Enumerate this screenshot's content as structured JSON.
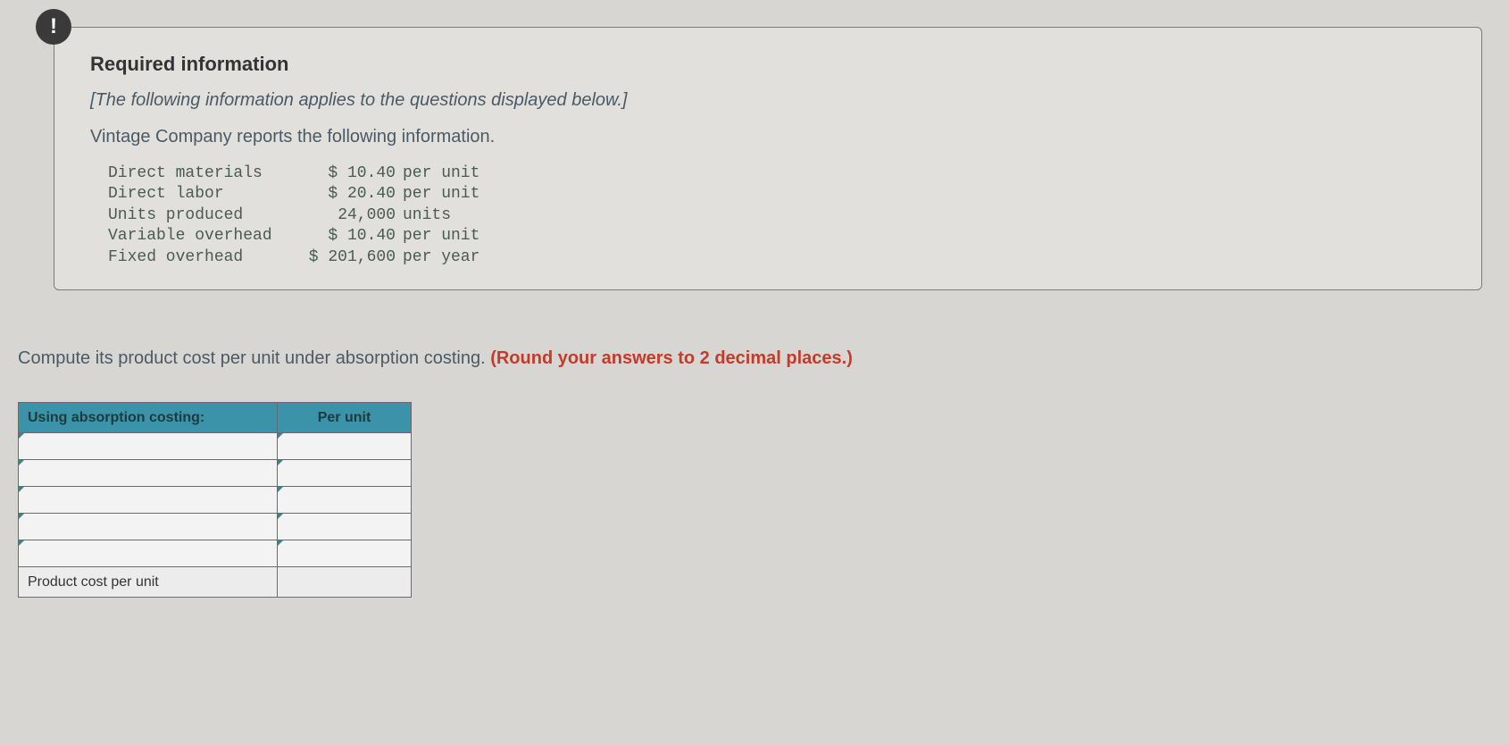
{
  "badge": "!",
  "info": {
    "heading": "Required information",
    "note": "[The following information applies to the questions displayed below.]",
    "lead": "Vintage Company reports the following information.",
    "rows": [
      {
        "label": "Direct materials",
        "value": "$ 10.40",
        "unit": "per unit"
      },
      {
        "label": "Direct labor",
        "value": "$ 20.40",
        "unit": "per unit"
      },
      {
        "label": "Units produced",
        "value": "24,000",
        "unit": "units"
      },
      {
        "label": "Variable overhead",
        "value": "$ 10.40",
        "unit": "per unit"
      },
      {
        "label": "Fixed overhead",
        "value": "$ 201,600",
        "unit": "per year"
      }
    ]
  },
  "prompt": {
    "text": "Compute its product cost per unit under absorption costing. ",
    "emph": "(Round your answers to 2 decimal places.)"
  },
  "table": {
    "headers": {
      "col1": "Using absorption costing:",
      "col2": "Per unit"
    },
    "blank_rows": 5,
    "total_label": "Product cost per unit"
  }
}
